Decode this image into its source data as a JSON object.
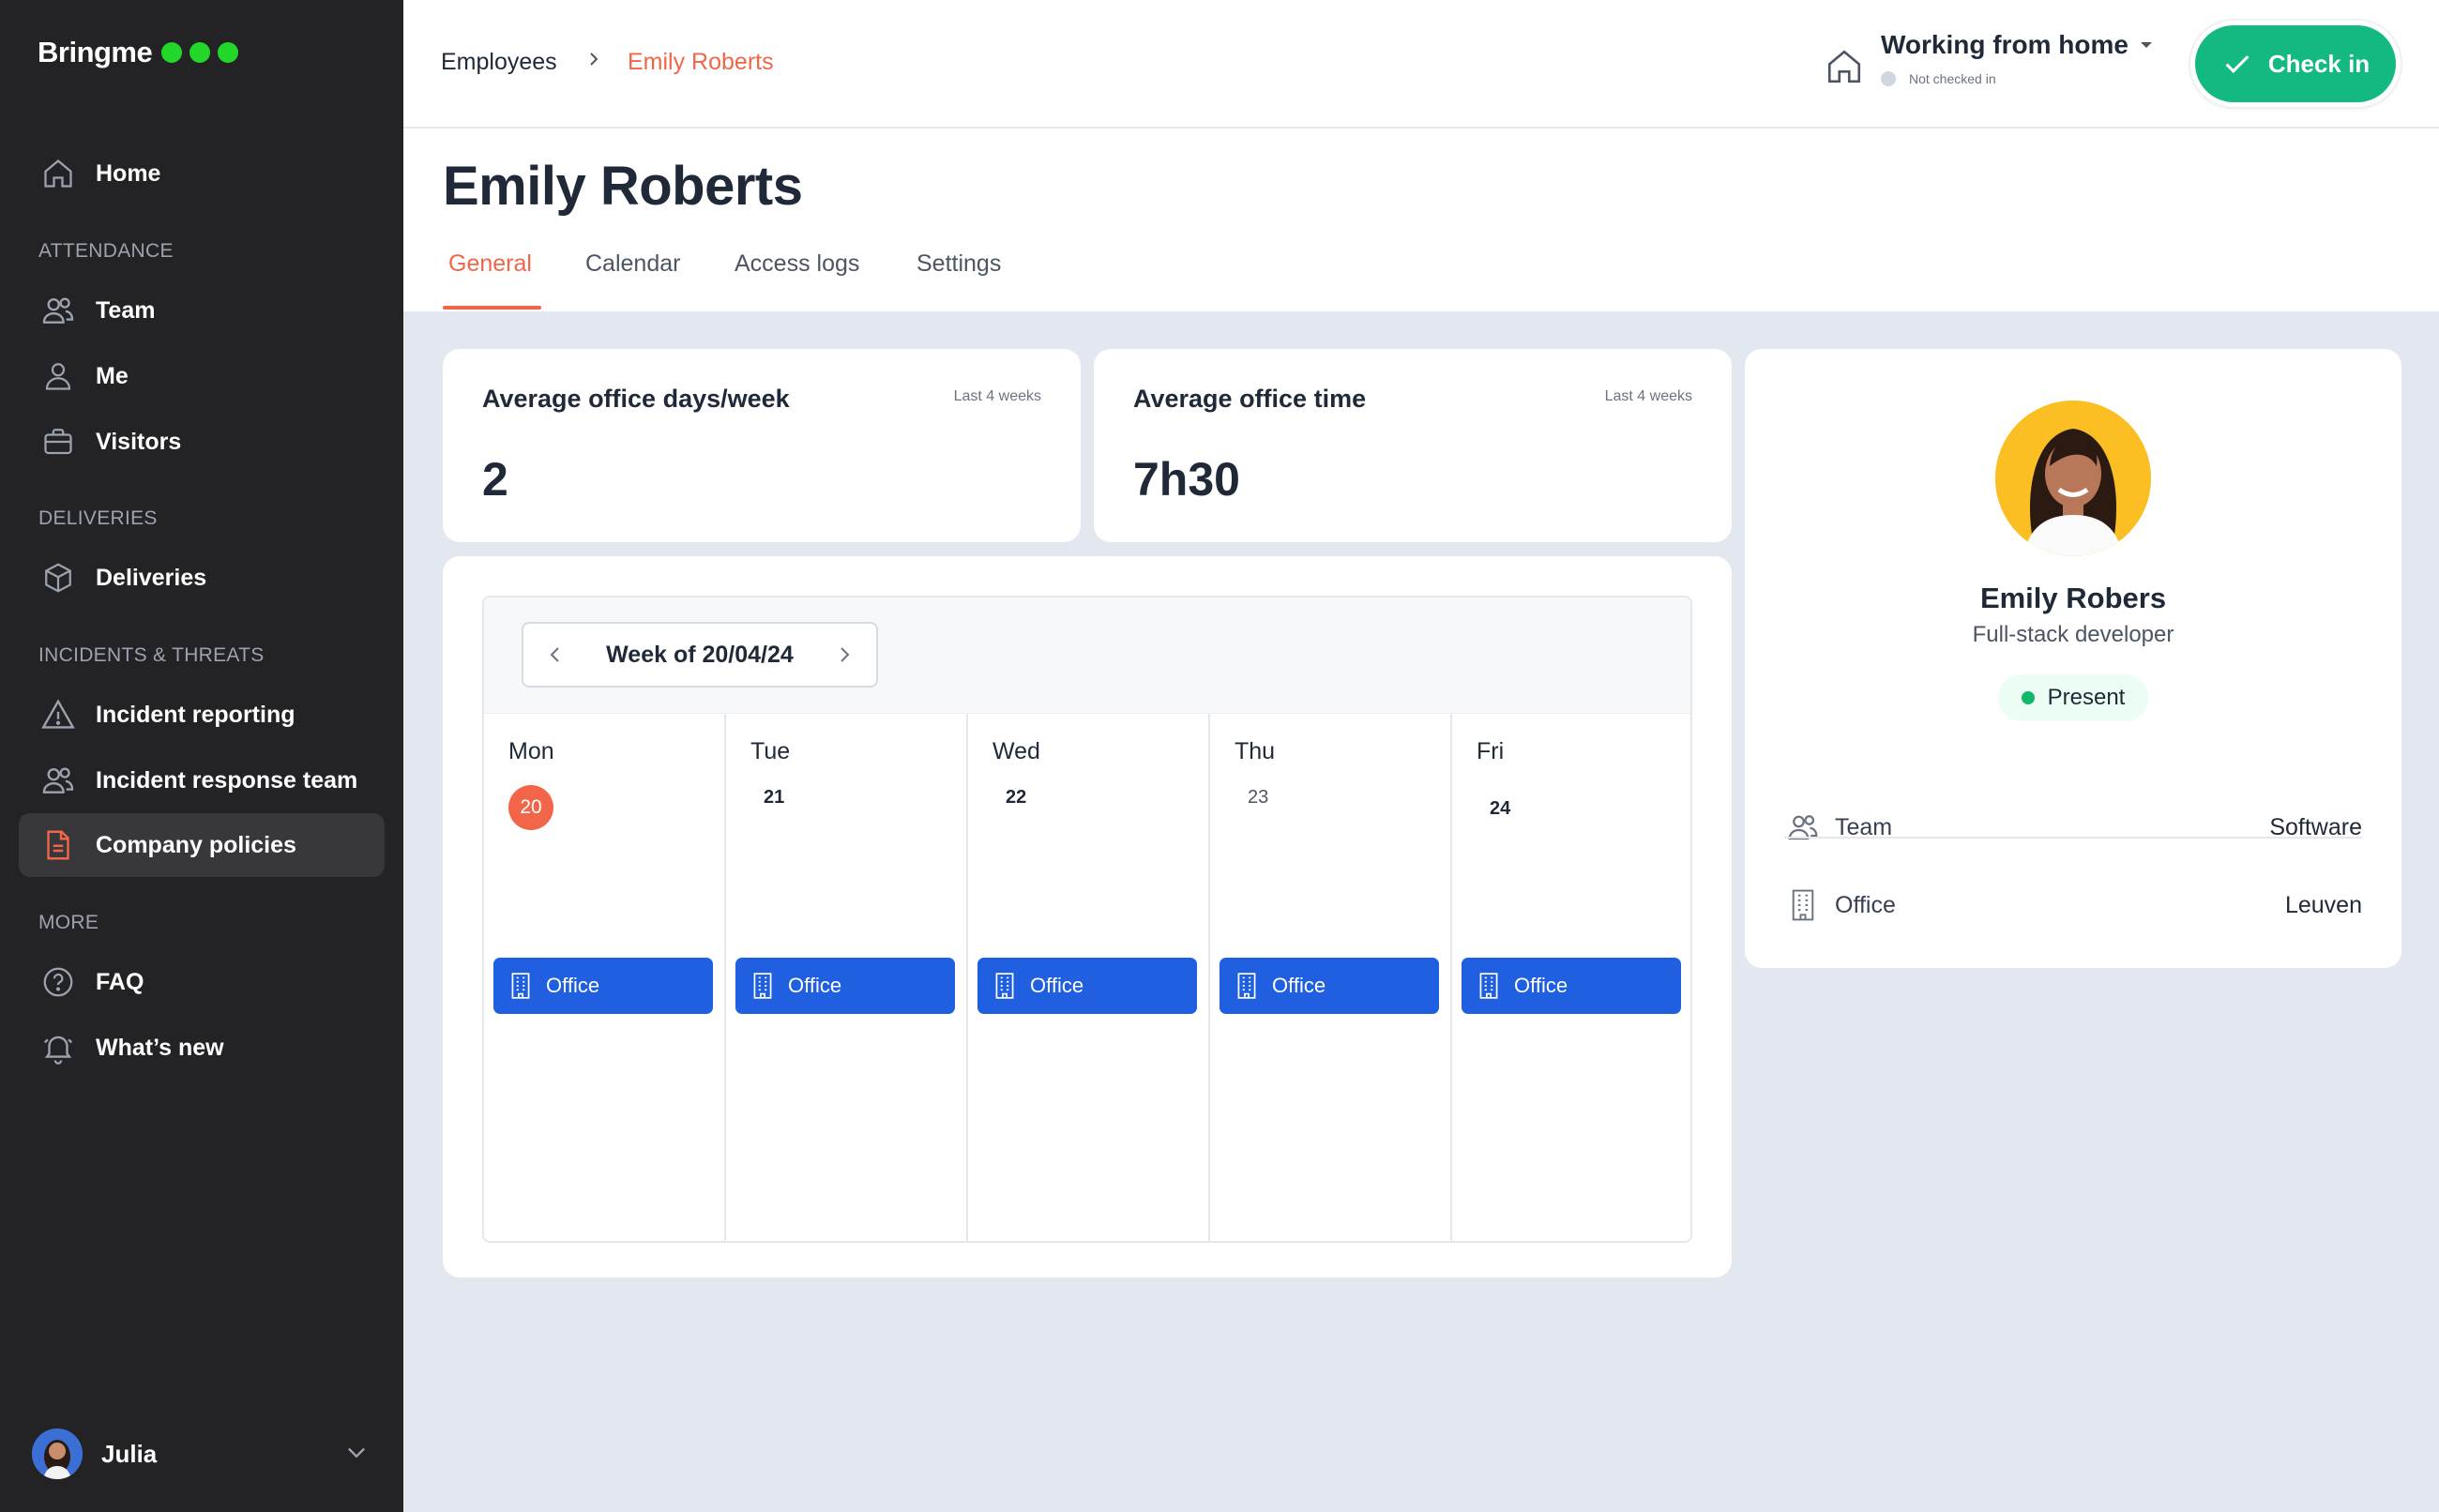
{
  "app": {
    "brand": "Bringme"
  },
  "colors": {
    "accent": "#f26548",
    "success": "#14b981",
    "primary": "#1f5fe0",
    "sidebar": "#232326",
    "brand_dots": "#22d62a"
  },
  "sidebar": {
    "home": {
      "label": "Home",
      "icon": "home-icon"
    },
    "sections": {
      "attendance": "ATTENDANCE",
      "deliveries": "DELIVERIES",
      "incidents": "INCIDENTS & THREATS",
      "more": "MORE"
    },
    "items": {
      "team": {
        "label": "Team",
        "icon": "users-icon"
      },
      "me": {
        "label": "Me",
        "icon": "user-icon"
      },
      "visitors": {
        "label": "Visitors",
        "icon": "briefcase-icon"
      },
      "deliveries": {
        "label": "Deliveries",
        "icon": "box-icon"
      },
      "incident_reporting": {
        "label": "Incident reporting",
        "icon": "warning-icon"
      },
      "incident_response": {
        "label": "Incident response team",
        "icon": "users-icon"
      },
      "company_policies": {
        "label": "Company policies",
        "icon": "document-icon",
        "active": true
      },
      "faq": {
        "label": "FAQ",
        "icon": "question-icon"
      },
      "whats_new": {
        "label": "What’s new",
        "icon": "bell-icon"
      }
    },
    "user": {
      "name": "Julia"
    }
  },
  "topbar": {
    "breadcrumb": {
      "parent": "Employees",
      "separator": "›",
      "current": "Emily Roberts"
    },
    "work_mode": {
      "title": "Working from home",
      "status": "Not checked in"
    },
    "checkin_label": "Check in"
  },
  "page": {
    "title": "Emily Roberts",
    "tabs": [
      {
        "label": "General",
        "active": true
      },
      {
        "label": "Calendar"
      },
      {
        "label": "Access logs"
      },
      {
        "label": "Settings"
      }
    ]
  },
  "stats": [
    {
      "title": "Average office days/week",
      "period": "Last 4 weeks",
      "value": "2"
    },
    {
      "title": "Average office time",
      "period": "Last 4 weeks",
      "value": "7h30"
    }
  ],
  "calendar": {
    "week_label": "Week of 20/04/24",
    "days": [
      {
        "name": "Mon",
        "num": "20",
        "today": true,
        "event": "Office"
      },
      {
        "name": "Tue",
        "num": "21",
        "event": "Office"
      },
      {
        "name": "Wed",
        "num": "22",
        "event": "Office"
      },
      {
        "name": "Thu",
        "num": "23",
        "event": "Office"
      },
      {
        "name": "Fri",
        "num": "24",
        "event": "Office"
      }
    ]
  },
  "profile": {
    "name": "Emily Robers",
    "role": "Full-stack developer",
    "status": "Present",
    "team_label": "Team",
    "team_value": "Software",
    "office_label": "Office",
    "office_value": "Leuven"
  }
}
